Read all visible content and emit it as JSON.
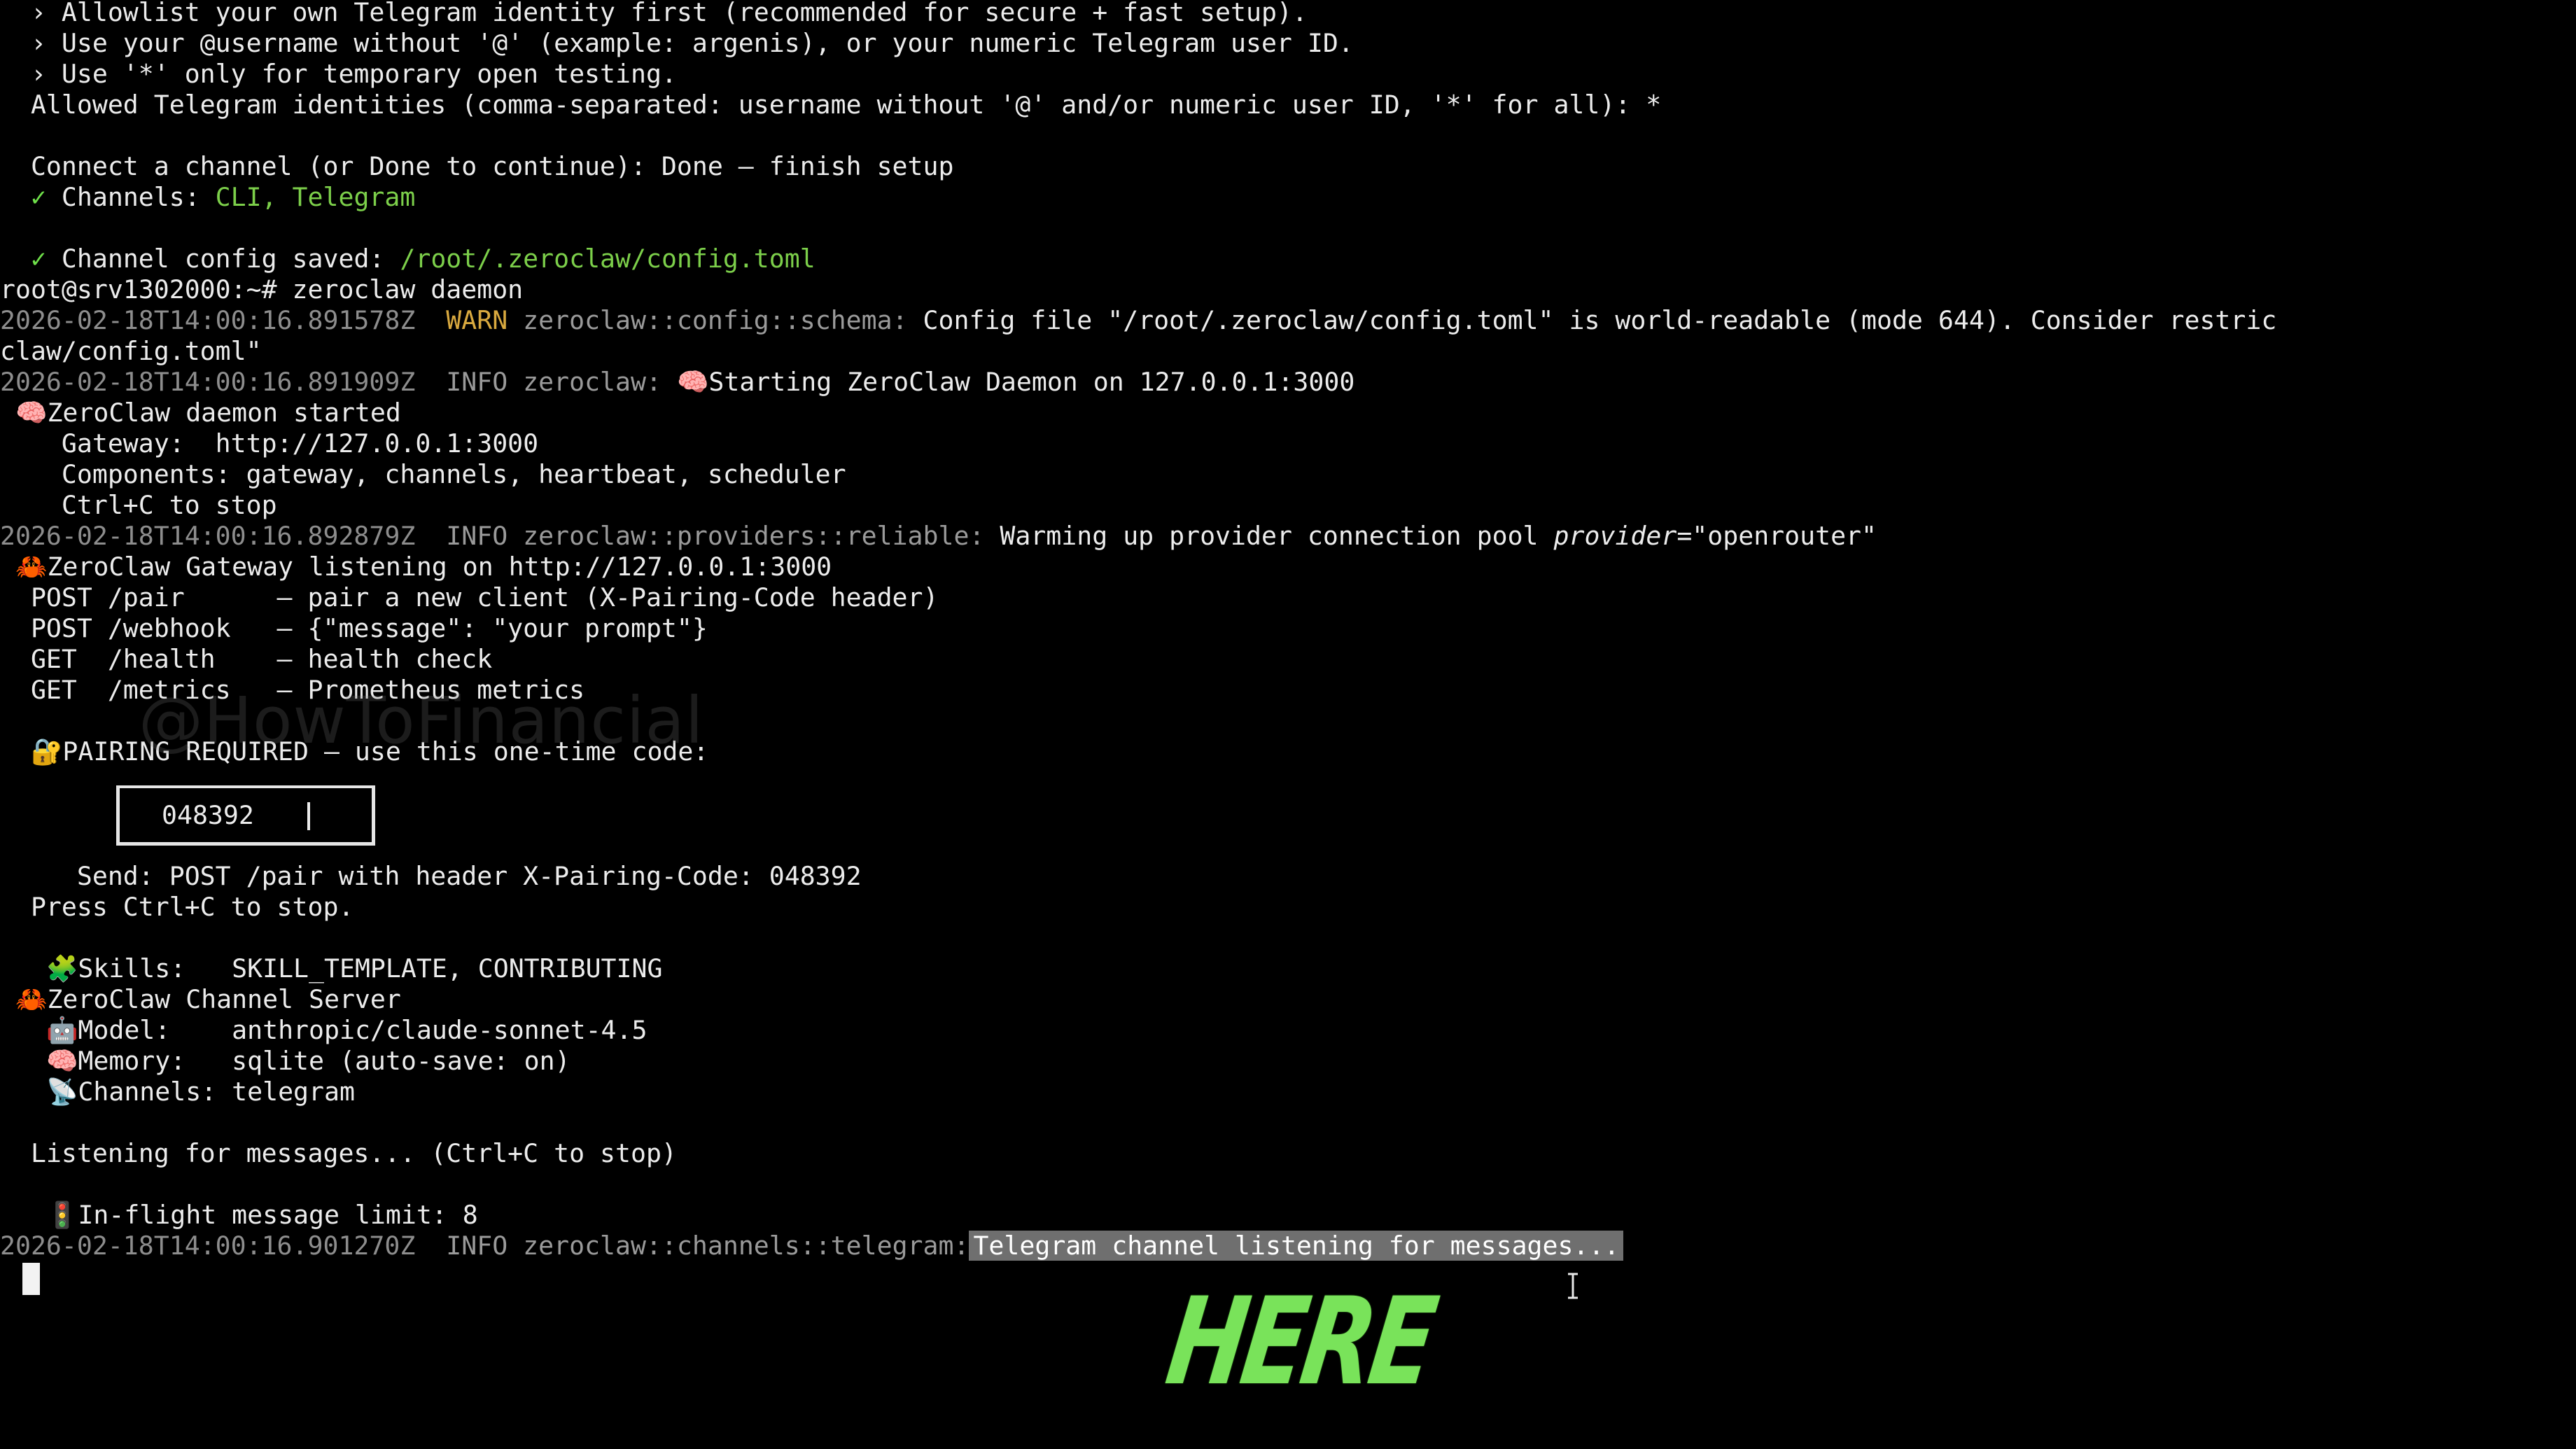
{
  "terminal": {
    "lines": {
      "l01": "  › Allowlist your own Telegram identity first (recommended for secure + fast setup).",
      "l02": "  › Use your @username without '@' (example: argenis), or your numeric Telegram user ID.",
      "l03": "  › Use '*' only for temporary open testing.",
      "l04": "  Allowed Telegram identities (comma-separated: username without '@' and/or numeric user ID, '*' for all): *",
      "l06": "  Connect a channel (or Done to continue): Done — finish setup",
      "l07_prefix": "Channels: ",
      "l07_value": "CLI, Telegram",
      "l09_prefix": "Channel config saved: ",
      "l09_value": "/root/.zeroclaw/config.toml",
      "l10": "root@srv1302000:~# zeroclaw daemon",
      "l11_ts": "2026-02-18T14:00:16.891578Z",
      "l11_level": "WARN",
      "l11_module": "zeroclaw::config::schema:",
      "l11_msg": "Config file \"/root/.zeroclaw/config.toml\" is world-readable (mode 644). Consider restric",
      "l12": "claw/config.toml\"",
      "l13_ts": "2026-02-18T14:00:16.891909Z",
      "l13_level": "INFO",
      "l13_module": "zeroclaw:",
      "l13_msg": "Starting ZeroClaw Daemon on 127.0.0.1:3000",
      "l14": "ZeroClaw daemon started",
      "l15": "    Gateway:  http://127.0.0.1:3000",
      "l16": "    Components: gateway, channels, heartbeat, scheduler",
      "l17": "    Ctrl+C to stop",
      "l18_ts": "2026-02-18T14:00:16.892879Z",
      "l18_level": "INFO",
      "l18_module": "zeroclaw::providers::reliable:",
      "l18_msg": "Warming up provider connection pool",
      "l18_key": "provider",
      "l18_val": "=\"openrouter\"",
      "l19": "ZeroClaw Gateway listening on http://127.0.0.1:3000",
      "l20": "  POST /pair      — pair a new client (X-Pairing-Code header)",
      "l21": "  POST /webhook   — {\"message\": \"your prompt\"}",
      "l22": "  GET  /health    — health check",
      "l23": "  GET  /metrics   — Prometheus metrics",
      "l25": "PAIRING REQUIRED — use this one-time code:",
      "pair_code": "048392",
      "l29": "     Send: POST /pair with header X-Pairing-Code: 048392",
      "l30": "  Press Ctrl+C to stop.",
      "l32_label": "Skills:",
      "l32_value": "   SKILL_TEMPLATE, CONTRIBUTING",
      "l33": "ZeroClaw Channel Server",
      "l34_label": "Model:",
      "l34_value": "    anthropic/claude-sonnet-4.5",
      "l35_label": "Memory:",
      "l35_value": "   sqlite (auto-save: on)",
      "l36_label": "Channels:",
      "l36_value": " telegram",
      "l38": "  Listening for messages... (Ctrl+C to stop)",
      "l40": "In-flight message limit: 8",
      "l41_ts": "2026-02-18T14:00:16.901270Z",
      "l41_level": "INFO",
      "l41_module": "zeroclaw::channels::telegram:",
      "l41_msg": "Telegram channel listening for messages..."
    },
    "icons": {
      "check": "✓",
      "brain": "🧠",
      "crab": "🦀",
      "lock": "🔐",
      "puzzle": "🧩",
      "robot": "🤖",
      "satellite": "📡",
      "traffic_light": "🚦"
    }
  },
  "watermark": "@HowToFinancial",
  "overlay_text": "HERE",
  "colors": {
    "background": "#000000",
    "text": "#ececec",
    "timestamp": "#8d8d8d",
    "warn": "#d9a93f",
    "green_path": "#7ccf4a",
    "overlay": "#79e35a"
  }
}
